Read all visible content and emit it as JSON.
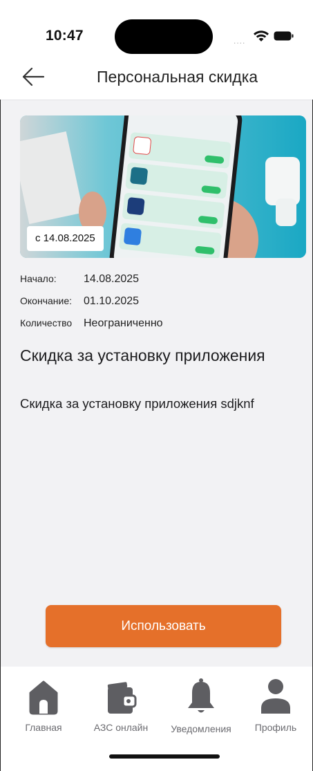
{
  "status_bar": {
    "time": "10:47",
    "signal": "....",
    "icons": [
      "wifi-icon",
      "battery-icon"
    ]
  },
  "header": {
    "title": "Персональная скидка",
    "back_icon": "arrow-left-icon"
  },
  "promo": {
    "date_badge": "с 14.08.2025",
    "image": "phone-installed-apps-photo"
  },
  "details": {
    "start_label": "Начало:",
    "start_value": "14.08.2025",
    "end_label": "Окончание:",
    "end_value": "01.10.2025",
    "qty_label": "Количество",
    "qty_value": "Неограниченно"
  },
  "offer": {
    "title": "Скидка за установку приложения",
    "description": "Скидка за установку приложения sdjknf"
  },
  "actions": {
    "use_label": "Использовать"
  },
  "tabs": [
    {
      "label": "Главная",
      "icon": "home-icon"
    },
    {
      "label": "АЗС онлайн",
      "icon": "wallet-icon"
    },
    {
      "label": "Уведомления",
      "icon": "bell-icon"
    },
    {
      "label": "Профиль",
      "icon": "profile-icon"
    }
  ],
  "colors": {
    "accent": "#e5702a",
    "background": "#f2f2f4",
    "icon_gray": "#5e5e62"
  }
}
